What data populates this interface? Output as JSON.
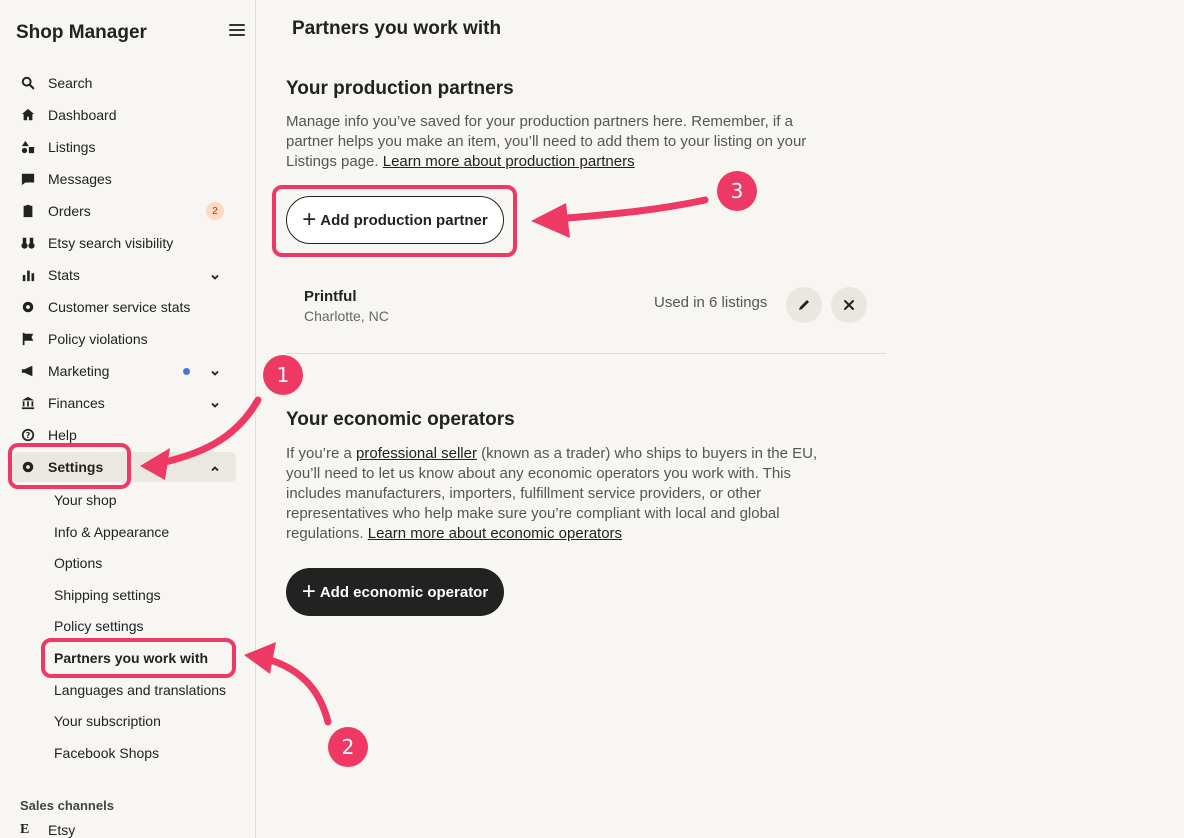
{
  "sidebar": {
    "brand": "Shop Manager",
    "items": [
      {
        "label": "Search",
        "icon": "search-icon"
      },
      {
        "label": "Dashboard",
        "icon": "home-icon"
      },
      {
        "label": "Listings",
        "icon": "shapes-icon"
      },
      {
        "label": "Messages",
        "icon": "message-icon"
      },
      {
        "label": "Orders",
        "icon": "clipboard-icon",
        "badge": "2"
      },
      {
        "label": "Etsy search visibility",
        "icon": "binoculars-icon"
      },
      {
        "label": "Stats",
        "icon": "bar-chart-icon"
      },
      {
        "label": "Customer service stats",
        "icon": "gear-icon"
      },
      {
        "label": "Policy violations",
        "icon": "flag-icon"
      },
      {
        "label": "Marketing",
        "icon": "megaphone-icon"
      },
      {
        "label": "Finances",
        "icon": "bank-icon"
      },
      {
        "label": "Help",
        "icon": "help-icon"
      },
      {
        "label": "Settings",
        "icon": "gear-icon"
      }
    ],
    "settings_sub": [
      "Your shop",
      "Info & Appearance",
      "Options",
      "Shipping settings",
      "Policy settings",
      "Partners you work with",
      "Languages and translations",
      "Your subscription",
      "Facebook Shops"
    ],
    "sales_channels_label": "Sales channels",
    "etsy_channel": "Etsy"
  },
  "main": {
    "page_title": "Partners you work with",
    "production": {
      "heading": "Your production partners",
      "desc": "Manage info you’ve saved for your production partners here. Remember, if a partner helps you make an item, you’ll need to add them to your listing on your Listings page.",
      "link": "Learn more about production partners",
      "button": "Add production partner",
      "partner": {
        "name": "Printful",
        "location": "Charlotte, NC",
        "usage": "Used in 6 listings"
      }
    },
    "economic": {
      "heading": "Your economic operators",
      "desc_pre": "If you’re a",
      "desc_link1": "professional seller",
      "desc_post": "(known as a trader) who ships to buyers in the EU, you’ll need to let us know about any economic operators you work with. This includes manufacturers, importers, fulfillment service providers, or other representatives who help make sure you’re compliant with local and global regulations.",
      "link": "Learn more about economic operators",
      "button": "Add economic operator"
    }
  },
  "annotations": {
    "step1": "1",
    "step2": "2",
    "step3": "3"
  },
  "colors": {
    "accent": "#ee3964",
    "dark_button": "#222222",
    "dot": "#4c73e0"
  }
}
